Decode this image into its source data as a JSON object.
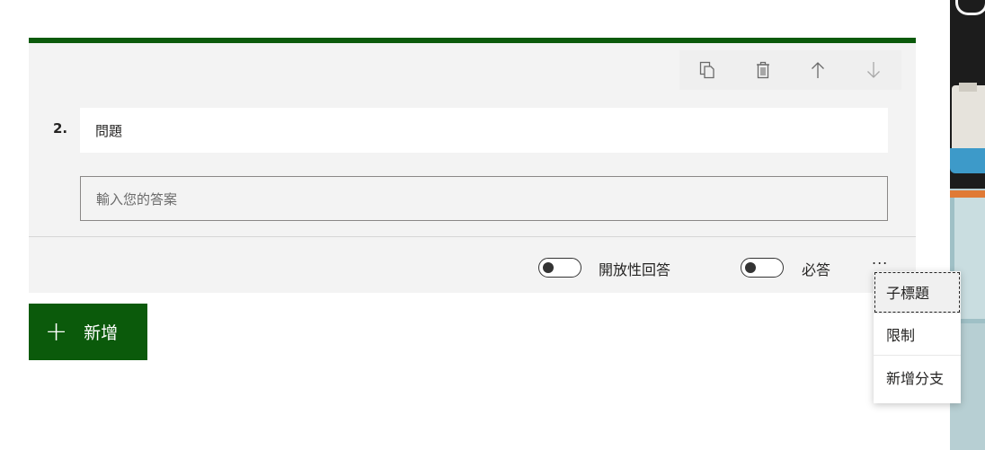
{
  "question": {
    "number": "2.",
    "title": "問題",
    "answer_placeholder": "輸入您的答案"
  },
  "toolbar": {
    "copy_icon": "copy-icon",
    "delete_icon": "trash-icon",
    "move_up_icon": "arrow-up-icon",
    "move_down_icon": "arrow-down-icon"
  },
  "options": {
    "long_answer_label": "開放性回答",
    "required_label": "必答",
    "more_label": "..."
  },
  "add_button": {
    "label": "新增"
  },
  "more_menu": {
    "items": [
      {
        "label": "子標題"
      },
      {
        "label": "限制"
      },
      {
        "label": "新增分支"
      }
    ]
  },
  "colors": {
    "accent": "#0b5a0b",
    "card_bg": "#f3f3f3"
  }
}
